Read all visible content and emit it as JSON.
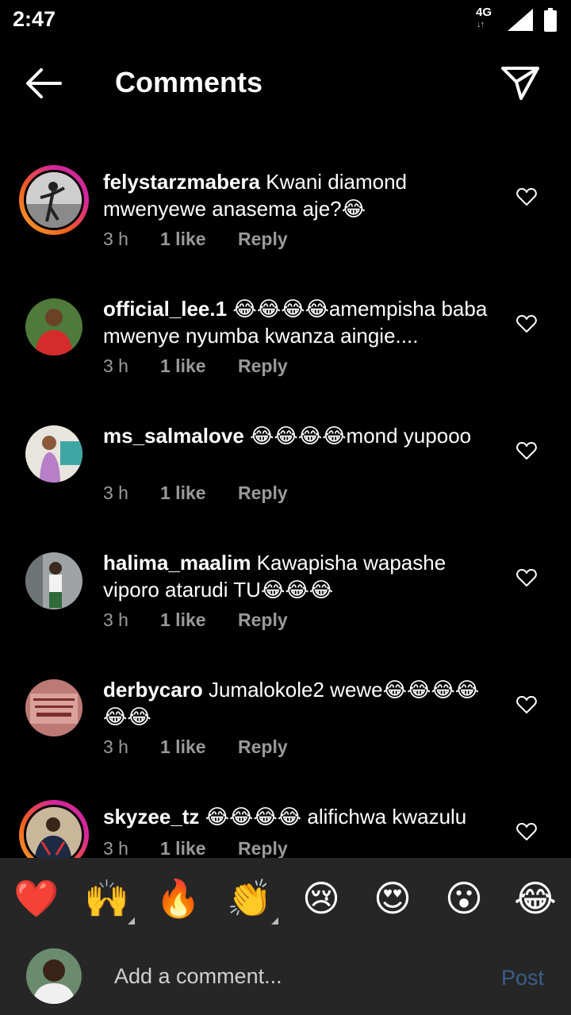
{
  "status_bar": {
    "time": "2:47",
    "network": "4G",
    "network_arrows": "↓↑"
  },
  "header": {
    "title": "Comments",
    "back_icon": "arrow-left-icon",
    "share_icon": "paper-plane-icon"
  },
  "comments": [
    {
      "username": "felystarzmabera",
      "text": "Kwani diamond mwenyewe anasema aje?😂",
      "time": "3 h",
      "likes": "1 like",
      "reply": "Reply",
      "has_story": true
    },
    {
      "username": "official_lee.1",
      "text": "😂😂😂😂amempisha baba mwenye nyumba kwanza aingie....",
      "time": "3 h",
      "likes": "1 like",
      "reply": "Reply",
      "has_story": false
    },
    {
      "username": "ms_salmalove",
      "text": "😂😂😂😂mond yupooo",
      "time": "3 h",
      "likes": "1 like",
      "reply": "Reply",
      "has_story": false
    },
    {
      "username": "halima_maalim",
      "text": "Kawapisha wapashe viporo atarudi TU😂😂😂",
      "time": "3 h",
      "likes": "1 like",
      "reply": "Reply",
      "has_story": false
    },
    {
      "username": "derbycaro",
      "text": "Jumalokole2 wewe😂😂😂😂😂😂",
      "time": "3 h",
      "likes": "1 like",
      "reply": "Reply",
      "has_story": false
    },
    {
      "username": "skyzee_tz",
      "text": "😂😂😂😂 alifichwa kwazulu",
      "time": "3 h",
      "likes": "1 like",
      "reply": "Reply",
      "has_story": true
    }
  ],
  "reactions": [
    "❤️",
    "🙌",
    "🔥",
    "👏",
    "😢",
    "😍",
    "😮",
    "😂"
  ],
  "composer": {
    "placeholder": "Add a comment...",
    "post_label": "Post"
  },
  "colors": {
    "background": "#000000",
    "bottom_bar": "#262626",
    "meta_text": "#9a9a9a",
    "post_disabled": "#3a5f8c"
  }
}
